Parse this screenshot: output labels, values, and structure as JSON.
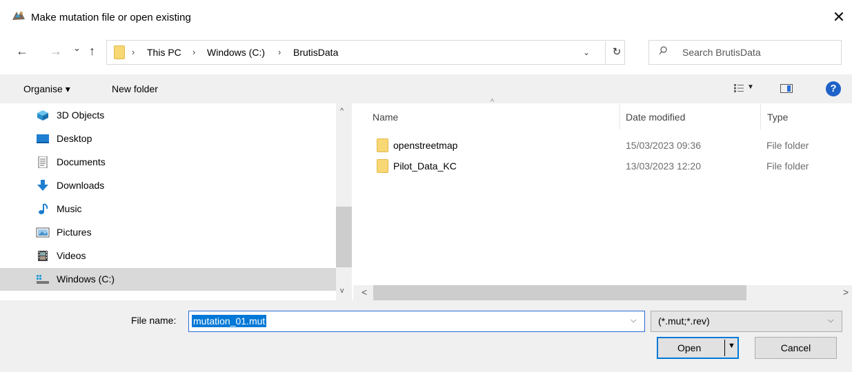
{
  "window": {
    "title": "Make mutation file or open existing",
    "close_glyph": "✕"
  },
  "navigation": {
    "back_glyph": "←",
    "forward_glyph": "→",
    "recent_glyph": "⌄",
    "up_glyph": "↑",
    "breadcrumbs": [
      "This PC",
      "Windows  (C:)",
      "BrutisData"
    ],
    "separator": "›",
    "dropdown_glyph": "⌄",
    "refresh_glyph": "↻",
    "search_placeholder": "Search BrutisData"
  },
  "toolbar": {
    "organise_label": "Organise ▾",
    "new_folder_label": "New folder",
    "help_glyph": "?"
  },
  "sidebar": {
    "items": [
      {
        "label": "3D Objects",
        "icon": "cube-icon",
        "color": "#3aa0d8"
      },
      {
        "label": "Desktop",
        "icon": "desktop-icon",
        "color": "#1e7fd0"
      },
      {
        "label": "Documents",
        "icon": "document-icon",
        "color": "#666666"
      },
      {
        "label": "Downloads",
        "icon": "download-icon",
        "color": "#1e7fd0"
      },
      {
        "label": "Music",
        "icon": "music-icon",
        "color": "#1e7fd0"
      },
      {
        "label": "Pictures",
        "icon": "pictures-icon",
        "color": "#4a90c8"
      },
      {
        "label": "Videos",
        "icon": "videos-icon",
        "color": "#555555"
      },
      {
        "label": "Windows  (C:)",
        "icon": "drive-icon",
        "color": "#2a9fd6",
        "selected": true
      }
    ]
  },
  "file_list": {
    "columns": {
      "name": "Name",
      "date": "Date modified",
      "type": "Type"
    },
    "sort_glyph": "^",
    "rows": [
      {
        "name": "openstreetmap",
        "date": "15/03/2023 09:36",
        "type": "File folder"
      },
      {
        "name": "Pilot_Data_KC",
        "date": "13/03/2023 12:20",
        "type": "File folder"
      }
    ]
  },
  "scroll": {
    "up": "^",
    "down": "v",
    "left": "<",
    "right": ">"
  },
  "footer": {
    "file_name_label": "File name:",
    "file_name_value": "mutation_01.mut",
    "filter_value": "(*.mut;*.rev)",
    "dropdown_glyph": "⌵",
    "open_label": "Open",
    "open_arrow": "▼",
    "cancel_label": "Cancel"
  },
  "colors": {
    "accent": "#0078d7",
    "folder": "#f8d775",
    "help": "#1e62c8"
  }
}
